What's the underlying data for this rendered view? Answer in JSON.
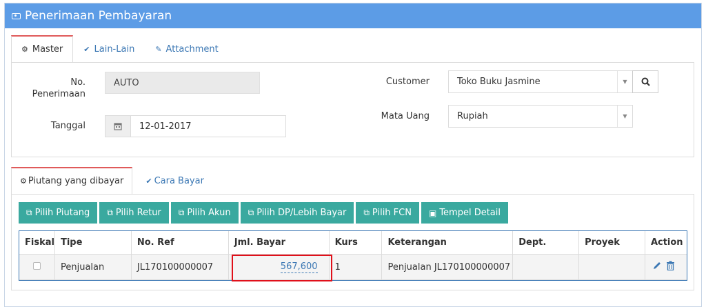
{
  "page_title": "Penerimaan Pembayaran",
  "master_tabs": [
    {
      "label": "Master",
      "icon": "gears-icon"
    },
    {
      "label": "Lain-Lain",
      "icon": "check-circle-icon"
    },
    {
      "label": "Attachment",
      "icon": "paperclip-icon"
    }
  ],
  "form": {
    "no_penerimaan_label_1": "No.",
    "no_penerimaan_label_2": "Penerimaan",
    "no_penerimaan_value": "AUTO",
    "tanggal_label": "Tanggal",
    "tanggal_value": "12-01-2017",
    "customer_label": "Customer",
    "customer_value": "Toko Buku Jasmine",
    "mata_uang_label": "Mata Uang",
    "mata_uang_value": "Rupiah"
  },
  "detail_tabs": [
    {
      "label": "Piutang yang dibayar",
      "icon": "gears-icon"
    },
    {
      "label": "Cara Bayar",
      "icon": "check-circle-icon"
    }
  ],
  "toolbar": {
    "pilih_piutang": "Pilih Piutang",
    "pilih_retur": "Pilih Retur",
    "pilih_akun": "Pilih Akun",
    "pilih_dp": "Pilih DP/Lebih Bayar",
    "pilih_fcn": "Pilih FCN",
    "tempel_detail": "Tempel Detail"
  },
  "table": {
    "headers": [
      "Fiskal",
      "Tipe",
      "No. Ref",
      "Jml. Bayar",
      "Kurs",
      "Keterangan",
      "Dept.",
      "Proyek",
      "Action"
    ],
    "rows": [
      {
        "fiskal": false,
        "tipe": "Penjualan",
        "no_ref": "JL170100000007",
        "jml_bayar": "567,600",
        "kurs": "1",
        "keterangan": "Penjualan JL170100000007",
        "dept": "",
        "proyek": ""
      }
    ]
  },
  "colors": {
    "header_blue": "#5c9ce6",
    "button_teal": "#3aa99f",
    "link_blue": "#3c78b4",
    "highlight_red": "#e0101a"
  }
}
